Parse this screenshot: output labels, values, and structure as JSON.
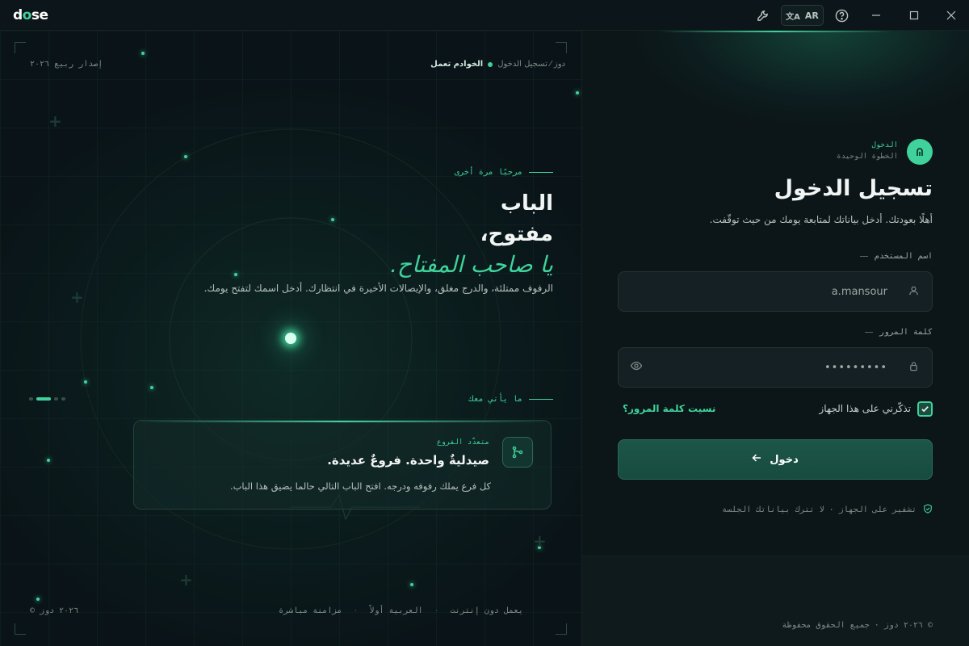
{
  "app": {
    "logo_prefix": "d",
    "logo_o": "o",
    "logo_suffix": "se",
    "lang": "AR"
  },
  "left": {
    "breadcrumb_path": "دوز ⁄ تسجيل الدخول",
    "status": "الخوادم تعمل",
    "release": "إصدار ربيع ٢٠٢٦",
    "welcome": "مرحبًا مرة أخرى",
    "hero_line1": "الباب",
    "hero_line2": "مفتوح،",
    "hero_line3": "يا صاحب المفتاح.",
    "hero_sub": "الرفوف ممتلئة، والدرج مغلق، والإيصالات الأخيرة في انتظارك. أدخل اسمك لتفتح يومك.",
    "coming": "ما يأتي معك",
    "card": {
      "kicker": "متعدّد الفروع",
      "title": "صيدليةٌ واحدة. فروعٌ عديدة.",
      "body": "كل فرع يملك رفوفه ودرجه. افتح الباب التالي حالما يضيق هذا الباب."
    },
    "footer_links": [
      "يعمل دون إنترنت",
      "العربية أولاً",
      "مزامنة مباشرة"
    ],
    "copyright": "© ٢٠٢٦ دوز"
  },
  "right": {
    "step_kicker": "الدخول",
    "step_note": "الخطوة الوحيدة",
    "title": "تسجيل الدخول",
    "subtitle": "أهلًا بعودتك. أدخل بياناتك لمتابعة يومك من حيث توقّفت.",
    "username_label": "اسم المستخدم",
    "username_value": "a.mansour",
    "password_label": "كلمة المرور",
    "password_value": "•••••••••",
    "remember": "تذكّرني على هذا الجهاز",
    "remember_checked": true,
    "forgot": "نسيت كلمة المرور؟",
    "signin": "دخول",
    "secure": "تشفير على الجهاز · لا تترك بياناتك الجلسة",
    "copyright": "© ٢٠٢٦ دوز · جميع الحقوق محفوظة"
  },
  "colors": {
    "accent": "#3fd29b",
    "bg": "#0a1418"
  }
}
